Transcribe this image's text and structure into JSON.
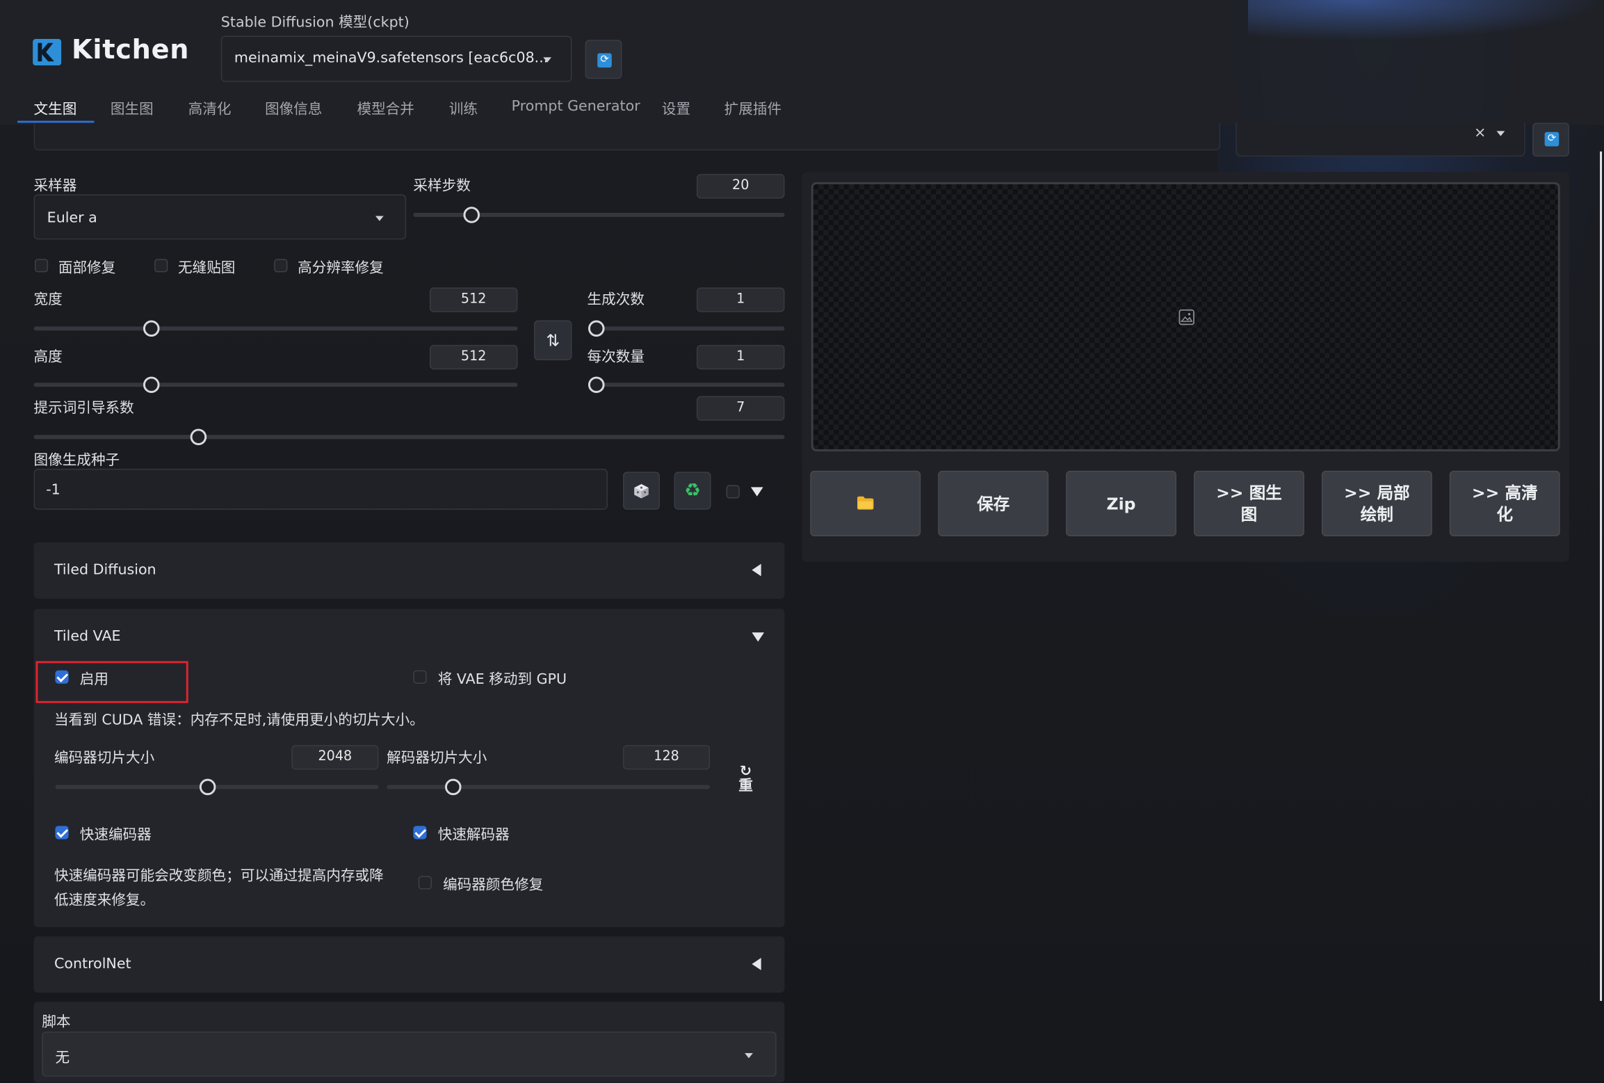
{
  "app": {
    "name": "Kitchen"
  },
  "model_selector": {
    "label": "Stable Diffusion 模型(ckpt)",
    "value": "meinamix_meinaV9.safetensors [eac6c08..."
  },
  "tabs": [
    {
      "label": "文生图",
      "active": true
    },
    {
      "label": "图生图"
    },
    {
      "label": "高清化"
    },
    {
      "label": "图像信息"
    },
    {
      "label": "模型合并"
    },
    {
      "label": "训练"
    },
    {
      "label": "Prompt Generator"
    },
    {
      "label": "设置"
    },
    {
      "label": "扩展插件"
    }
  ],
  "style_clear_symbol": "×",
  "sampler": {
    "label": "采样器",
    "value": "Euler a"
  },
  "steps": {
    "label": "采样步数",
    "value": "20",
    "fraction": 0.14
  },
  "toggles": [
    {
      "label": "面部修复",
      "checked": false
    },
    {
      "label": "无缝贴图",
      "checked": false
    },
    {
      "label": "高分辨率修复",
      "checked": false
    }
  ],
  "width": {
    "label": "宽度",
    "value": "512",
    "fraction": 0.235
  },
  "height": {
    "label": "高度",
    "value": "512",
    "fraction": 0.235
  },
  "batch_count": {
    "label": "生成次数",
    "value": "1",
    "fraction": 0.0
  },
  "batch_size": {
    "label": "每次数量",
    "value": "1",
    "fraction": 0.0
  },
  "cfg": {
    "label": "提示词引导系数",
    "value": "7",
    "fraction": 0.213
  },
  "seed": {
    "label": "图像生成种子",
    "value": "-1"
  },
  "output_buttons": {
    "save": "保存",
    "zip": "Zip",
    "to_img2img": ">> 图生图",
    "to_inpaint": ">> 局部绘制",
    "to_extras": ">> 高清化"
  },
  "tiled_diffusion": {
    "title": "Tiled Diffusion"
  },
  "tiled_vae": {
    "title": "Tiled VAE",
    "enable_label": "启用",
    "enable_checked": true,
    "move_vae_label": "将 VAE 移动到 GPU",
    "move_vae_checked": false,
    "note": "当看到 CUDA 错误：内存不足时,请使用更小的切片大小。",
    "encoder_tile": {
      "label": "编码器切片大小",
      "value": "2048",
      "fraction": 0.47
    },
    "decoder_tile": {
      "label": "解码器切片大小",
      "value": "128",
      "fraction": 0.19
    },
    "reset_label": "重",
    "fast_encoder_label": "快速编码器",
    "fast_encoder_checked": true,
    "fast_decoder_label": "快速解码器",
    "fast_decoder_checked": true,
    "fast_encoder_note": "快速编码器可能会改变颜色；可以通过提高内存或降低速度来修复。",
    "color_fix_label": "编码器颜色修复",
    "color_fix_checked": false
  },
  "controlnet": {
    "title": "ControlNet"
  },
  "script": {
    "label": "脚本",
    "value": "无"
  },
  "colors": {
    "accent": "#2f6fd6",
    "highlight_box": "#e0242f",
    "refresh_icon": "#2d8fd8",
    "folder_icon": "#f0b429",
    "recycle_icon": "#3ac267"
  }
}
